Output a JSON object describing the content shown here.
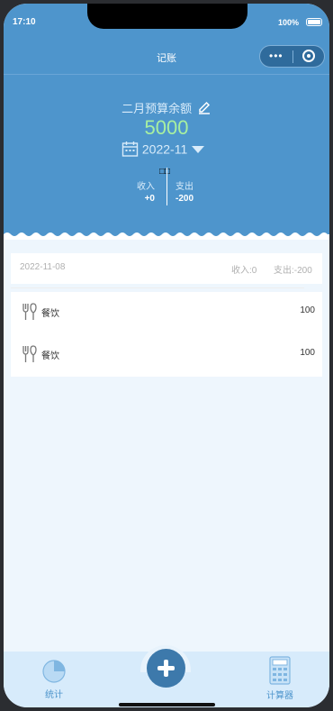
{
  "status_bar": {
    "time": "17:10",
    "battery": "100%"
  },
  "nav": {
    "title": "记账"
  },
  "budget": {
    "label": "二月预算余额",
    "value": "5000",
    "month": "2022-11",
    "icon_glyphs": "□□"
  },
  "stats": {
    "income_label": "收入",
    "income_value": "+0",
    "expense_label": "支出",
    "expense_value": "-200"
  },
  "day_summary": {
    "date": "2022-11-08",
    "income": "收入:0",
    "expense": "支出:-200"
  },
  "records": [
    {
      "icon": "fork-knife-icon",
      "category": "餐饮",
      "amount": "100"
    },
    {
      "icon": "fork-knife-icon",
      "category": "餐饮",
      "amount": "100"
    }
  ],
  "tabbar": {
    "left_label": "统计",
    "right_label": "计算器",
    "center_icon": "plus-icon"
  },
  "colors": {
    "header": "#4e95cc",
    "budget_value": "#a8f0a0",
    "tabbar": "#d7ebfb",
    "fab": "#3d79ab"
  }
}
